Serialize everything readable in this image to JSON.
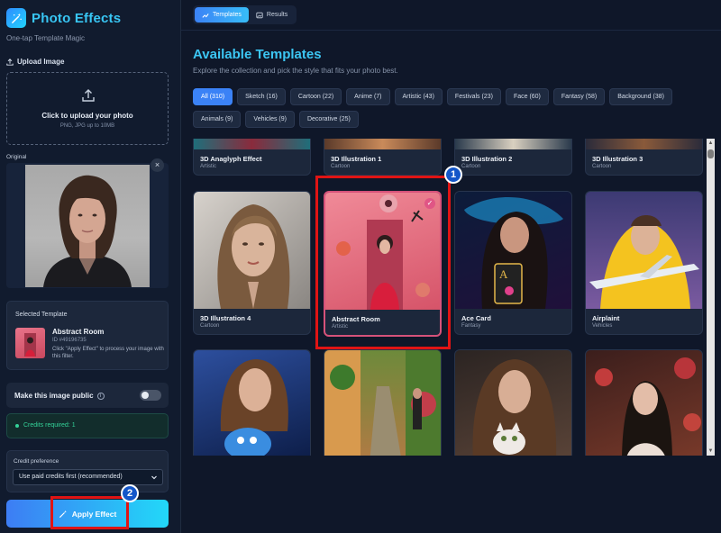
{
  "brand": {
    "title": "Photo Effects",
    "subtitle": "One-tap Template Magic"
  },
  "upload": {
    "label": "Upload Image",
    "title": "Click to upload your photo",
    "hint": "PNG, JPG up to 10MB"
  },
  "original": {
    "label": "Original",
    "close": "×"
  },
  "selected_template": {
    "label": "Selected Template",
    "name": "Abstract Room",
    "id": "ID #49196735",
    "description": "Click \"Apply Effect\" to process your image with this filter."
  },
  "public_toggle": {
    "label": "Make this image public",
    "info": "i",
    "enabled": false
  },
  "credits": {
    "text": "Credits required: 1"
  },
  "credit_preference": {
    "label": "Credit preference",
    "selected": "Use paid credits first (recommended)"
  },
  "apply_button": {
    "label": "Apply Effect"
  },
  "tabs": [
    {
      "label": "Templates",
      "active": true
    },
    {
      "label": "Results",
      "active": false
    }
  ],
  "main": {
    "title": "Available Templates",
    "subtitle": "Explore the collection and pick the style that fits your photo best."
  },
  "categories": [
    {
      "label": "All (310)",
      "active": true
    },
    {
      "label": "Sketch (16)"
    },
    {
      "label": "Cartoon (22)"
    },
    {
      "label": "Anime (7)"
    },
    {
      "label": "Artistic (43)"
    },
    {
      "label": "Festivals (23)"
    },
    {
      "label": "Face (60)"
    },
    {
      "label": "Fantasy (58)"
    },
    {
      "label": "Background (38)"
    },
    {
      "label": "Animals (9)"
    },
    {
      "label": "Vehicles (9)"
    },
    {
      "label": "Decorative (25)"
    }
  ],
  "templates": [
    {
      "name": "3D Anaglyph Effect",
      "category": "Artistic"
    },
    {
      "name": "3D Illustration 1",
      "category": "Cartoon"
    },
    {
      "name": "3D Illustration 2",
      "category": "Cartoon"
    },
    {
      "name": "3D Illustration 3",
      "category": "Cartoon"
    },
    {
      "name": "3D Illustration 4",
      "category": "Cartoon"
    },
    {
      "name": "Abstract Room",
      "category": "Artistic",
      "selected": true
    },
    {
      "name": "Ace Card",
      "category": "Fantasy"
    },
    {
      "name": "Airplaint",
      "category": "Vehicles"
    }
  ],
  "callouts": [
    "1",
    "2"
  ],
  "colors": {
    "accent": "#3b82f6",
    "brand_cyan": "#38c6f4",
    "success": "#34d399",
    "highlight": "#e01414",
    "bg": "#0f1729"
  }
}
